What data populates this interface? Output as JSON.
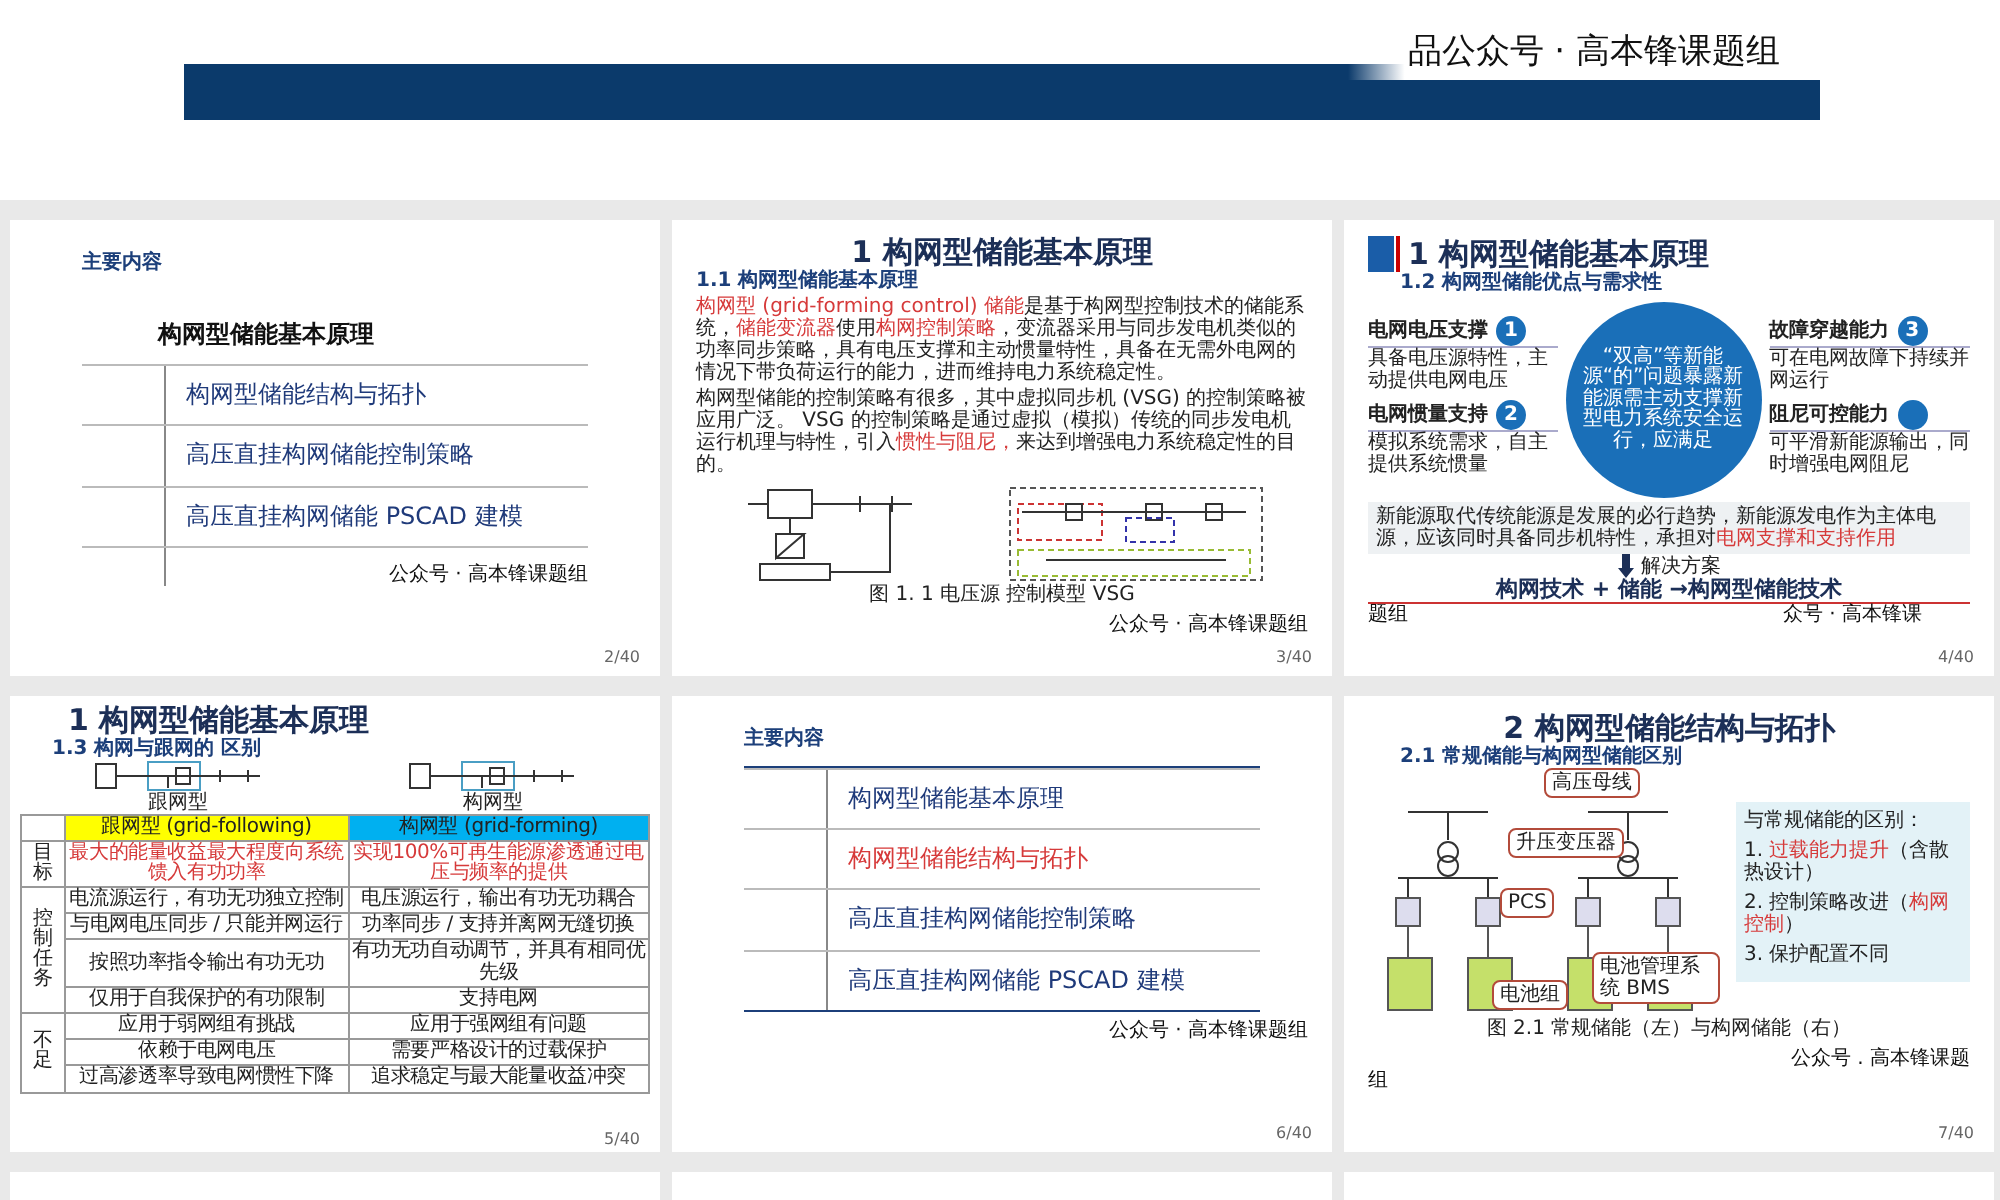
{
  "top_page": {
    "footer": "品公众号 · 高本锋课题组"
  },
  "slides": [
    {
      "kind": "toc",
      "title": "主要内容",
      "heading": "构网型储能基本原理",
      "items": [
        {
          "text": "构网型储能结构与拓扑"
        },
        {
          "text": "高压直挂构网储能控制策略"
        },
        {
          "text": "高压直挂构网储能 PSCAD 建模"
        }
      ],
      "footer": "公众号 · 高本锋课题组",
      "page": "2/40"
    },
    {
      "kind": "principle",
      "title": "1 构网型储能基本原理",
      "subtitle": "1.1 构网型储能基本原理",
      "paragraphs": [
        [
          {
            "text": "构网型 (grid-forming control) 储能",
            "highlighted": true
          },
          {
            "text": "是基于构网型控制技术的储能系统，",
            "highlighted": false
          },
          {
            "text": "储能变流器",
            "highlighted": true
          },
          {
            "text": "使用",
            "highlighted": false
          },
          {
            "text": "构网控制策略",
            "highlighted": true
          },
          {
            "text": "，变流器采用与同步发电机类似的功率同步策略，具有电压支撑和主动惯量特性，具备在无需外电网的情况下带负荷运行的能力，进而维持电力系统稳定性。",
            "highlighted": false
          }
        ],
        [
          {
            "text": "构网型储能的控制策略有很多，其中虚拟同步机 (VSG) 的控制策略被应用广泛。 VSG 的控制策略是通过虚拟（模拟）传统的同步发电机运行机理与特性，引入",
            "highlighted": false
          },
          {
            "text": "惯性与阻尼，",
            "highlighted": true
          },
          {
            "text": "来达到增强电力系统稳定性的目的。",
            "highlighted": false
          }
        ]
      ],
      "caption": "图 1. 1 电压源 控制模型 VSG",
      "footer": "公众号 · 高本锋课题组",
      "page": "3/40"
    },
    {
      "kind": "advantages",
      "title": "1 构网型储能基本原理",
      "subtitle": "1.2 构网型储能优点与需求性",
      "points": [
        {
          "number": "1",
          "label": "电网电压支撑",
          "desc": "具备电压源特性，主动提供电网电压"
        },
        {
          "number": "2",
          "label": "电网惯量支持",
          "desc": "模拟系统需求，自主提供系统惯量"
        },
        {
          "number": "3",
          "label": "故障穿越能力",
          "desc": "可在电网故障下持续并网运行"
        },
        {
          "label": "阻尼可控能力",
          "desc": "可平滑新能源输出，同时增强电网阻尼"
        }
      ],
      "center": "“双高”等新能源“的”问题暴露新能源需主动支撑新型电力系统安全运行，应满足",
      "box": [
        {
          "text": "新能源取代传统能源是发展的必行趋势，新能源发电作为主体电源，应该同时具备同步机特性，承担对",
          "highlighted": false
        },
        {
          "text": "电网支撑和支持作用",
          "highlighted": true
        }
      ],
      "solution": "解决方案",
      "conclusion": "构网技术 + 储能 →构网型储能技术",
      "footer": "众号 · 高本锋课",
      "footer_wrap": "题组",
      "page": "4/40"
    },
    {
      "kind": "comparison",
      "title": "1 构网型储能基本原理",
      "subtitle": "1.3 构网与跟网的 区别",
      "drawing_labels": [
        "跟网型",
        "构网型"
      ],
      "columns": [
        {
          "text": "跟网型 (grid-following)",
          "color": "#ffff00"
        },
        {
          "text": "构网型 (grid-forming)",
          "color": "#00b0f0"
        }
      ],
      "groups": [
        {
          "label": "目标",
          "highlighted": true,
          "rows": [
            [
              "最大的能量收益最大程度向系统馈入有功功率",
              "实现100%可再生能源渗透通过电压与频率的提供"
            ]
          ]
        },
        {
          "label": "控制任务",
          "highlighted": false,
          "rows": [
            [
              "电流源运行，有功无功独立控制",
              "电压源运行，输出有功无功耦合"
            ],
            [
              "与电网电压同步 / 只能并网运行",
              "功率同步 / 支持并离网无缝切换"
            ],
            [
              "按照功率指令输出有功无功",
              "有功无功自动调节，并具有相同优先级"
            ],
            [
              "仅用于自我保护的有功限制",
              "支持电网"
            ]
          ]
        },
        {
          "label": "不足",
          "highlighted": false,
          "rows": [
            [
              "应用于弱网组有挑战",
              "应用于强网组有问题"
            ],
            [
              "依赖于电网电压",
              "需要严格设计的过载保护"
            ],
            [
              "过高渗透率导致电网惯性下降",
              "追求稳定与最大能量收益冲突"
            ]
          ]
        }
      ],
      "page": "5/40"
    },
    {
      "kind": "toc_boxed",
      "title": "主要内容",
      "items": [
        {
          "text": "构网型储能基本原理",
          "selected": false
        },
        {
          "text": "构网型储能结构与拓扑",
          "selected": true
        },
        {
          "text": "高压直挂构网储能控制策略",
          "selected": false
        },
        {
          "text": "高压直挂构网储能 PSCAD 建模",
          "selected": false
        }
      ],
      "footer": "公众号 · 高本锋课题组",
      "page": "6/40"
    },
    {
      "kind": "topology",
      "title": "2 构网型储能结构与拓扑",
      "subtitle": "2.1 常规储能与构网型储能区别",
      "callouts": [
        "高压母线",
        "升压变压器",
        "PCS",
        "电池组",
        "电池管理系统 BMS"
      ],
      "notes_title": "与常规储能的区别：",
      "notes": [
        [
          {
            "text": "1. ",
            "highlighted": false
          },
          {
            "text": "过载能力提升",
            "highlighted": true
          },
          {
            "text": "（含散热设计）",
            "highlighted": false
          }
        ],
        [
          {
            "text": "2. 控制策略改进（",
            "highlighted": false
          },
          {
            "text": "构网控制",
            "highlighted": true
          },
          {
            "text": "）",
            "highlighted": false
          }
        ],
        [
          {
            "text": "3. 保护配置不同",
            "highlighted": false
          }
        ]
      ],
      "caption": "图 2.1 常规储能（左）与构网储能（右）",
      "footer": "公众号 . 高本锋课题",
      "footer_wrap": "组",
      "page": "7/40"
    },
    {
      "kind": "blank"
    },
    {
      "kind": "blank"
    },
    {
      "kind": "blank"
    }
  ]
}
